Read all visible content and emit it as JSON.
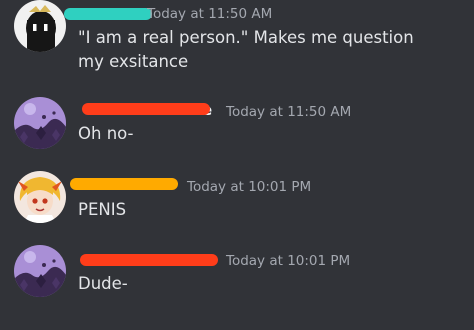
{
  "messages": [
    {
      "time": "Today at 11:50 AM",
      "text": "\"I am a real person.\" Makes me question my exsitance",
      "redaction_color": "#2fd0c0",
      "avatar": "dark-hooded-character-avatar"
    },
    {
      "name_fragment": "e",
      "time": "Today at 11:50 AM",
      "text": "Oh no-",
      "redaction_color": "#ff3d1a",
      "avatar": "purple-floral-avatar"
    },
    {
      "time": "Today at 10:01 PM",
      "text": "PENIS",
      "redaction_color": "#ffaa00",
      "avatar": "anime-blonde-character-avatar"
    },
    {
      "time": "Today at 10:01 PM",
      "text": "Dude-",
      "redaction_color": "#ff3d1a",
      "avatar": "purple-floral-avatar"
    }
  ]
}
